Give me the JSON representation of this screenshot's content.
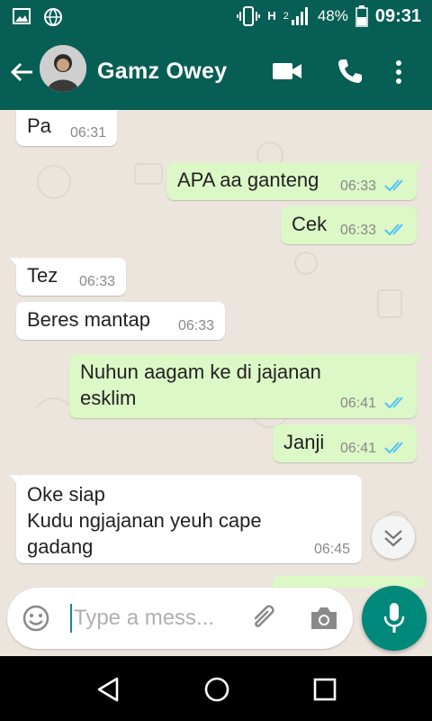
{
  "status_bar": {
    "network_label": "H",
    "sim_label": "2",
    "battery": "48%",
    "time": "09:31"
  },
  "header": {
    "contact_name": "Gamz Owey"
  },
  "messages": [
    {
      "dir": "in",
      "text": "Pa",
      "time": "06:31"
    },
    {
      "dir": "out",
      "text": "APA aa ganteng",
      "time": "06:33"
    },
    {
      "dir": "out",
      "text": "Cek",
      "time": "06:33"
    },
    {
      "dir": "in",
      "text": "Tez",
      "time": "06:33"
    },
    {
      "dir": "in",
      "text": "Beres mantap",
      "time": "06:33"
    },
    {
      "dir": "out",
      "text": "Nuhun aagam ke di  jajanan\nesklim",
      "time": "06:41"
    },
    {
      "dir": "out",
      "text": "Janji",
      "time": "06:41"
    },
    {
      "dir": "in",
      "text": "Oke siap\n Kudu ngjajanan yeuh cape\ngadang",
      "time": "06:45"
    }
  ],
  "composer": {
    "placeholder": "Type a mess..."
  },
  "colors": {
    "header": "#075e54",
    "outgoing_bubble": "#dcf8c6",
    "incoming_bubble": "#ffffff",
    "read_tick": "#4fc3f7",
    "mic_button": "#00897b"
  },
  "icons": [
    "image-icon",
    "globe-icon",
    "vibrate-icon",
    "signal-icon",
    "battery-icon",
    "back-arrow-icon",
    "video-call-icon",
    "phone-icon",
    "more-vert-icon",
    "chevron-down-icon",
    "emoji-icon",
    "attach-icon",
    "camera-icon",
    "mic-icon",
    "nav-back-icon",
    "nav-home-icon",
    "nav-recents-icon"
  ]
}
